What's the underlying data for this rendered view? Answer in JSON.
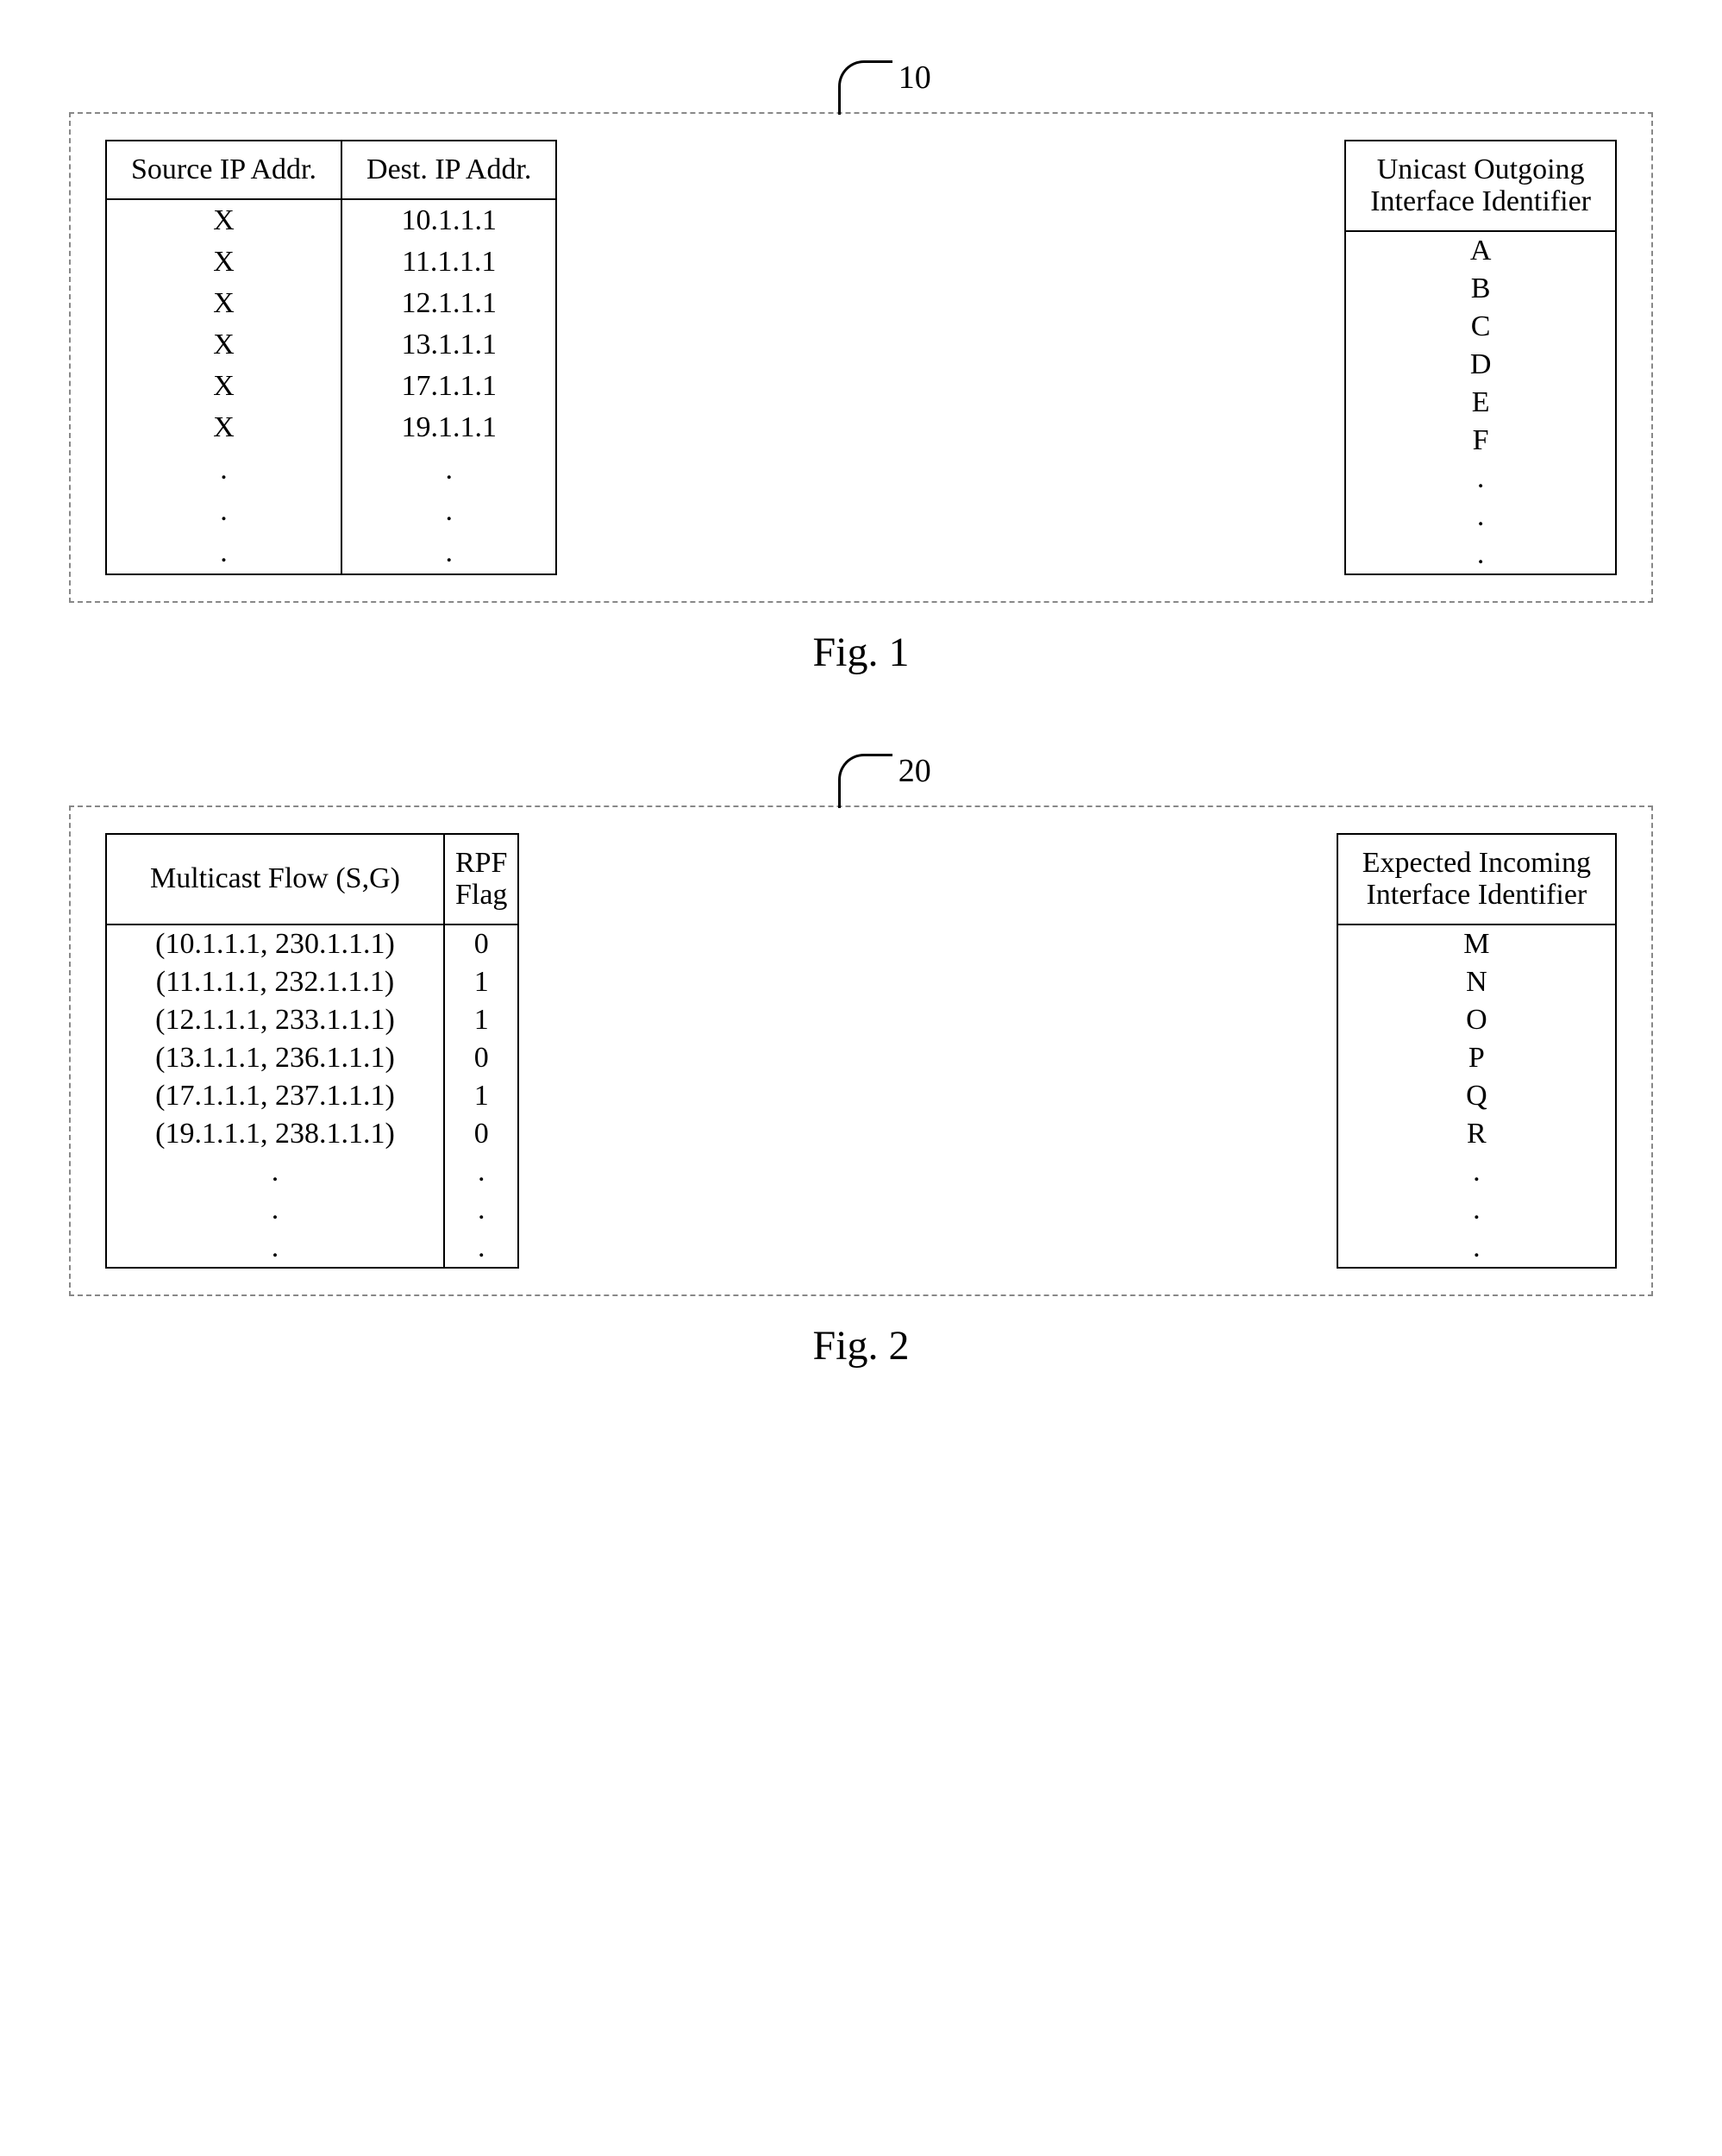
{
  "figure1": {
    "callout_label": "10",
    "caption": "Fig. 1",
    "left_table": {
      "headers": [
        "Source IP Addr.",
        "Dest. IP Addr."
      ],
      "rows": [
        [
          "X",
          "10.1.1.1"
        ],
        [
          "X",
          "11.1.1.1"
        ],
        [
          "X",
          "12.1.1.1"
        ],
        [
          "X",
          "13.1.1.1"
        ],
        [
          "X",
          "17.1.1.1"
        ],
        [
          "X",
          "19.1.1.1"
        ],
        [
          ".",
          "."
        ],
        [
          ".",
          "."
        ],
        [
          ".",
          "."
        ]
      ]
    },
    "right_table": {
      "header": "Unicast Outgoing\nInterface Identifier",
      "rows": [
        "A",
        "B",
        "C",
        "D",
        "E",
        "F",
        ".",
        ".",
        "."
      ]
    }
  },
  "figure2": {
    "callout_label": "20",
    "caption": "Fig. 2",
    "left_table": {
      "headers": [
        "Multicast Flow (S,G)",
        "RPF\nFlag"
      ],
      "rows": [
        [
          "(10.1.1.1, 230.1.1.1)",
          "0"
        ],
        [
          "(11.1.1.1, 232.1.1.1)",
          "1"
        ],
        [
          "(12.1.1.1, 233.1.1.1)",
          "1"
        ],
        [
          "(13.1.1.1, 236.1.1.1)",
          "0"
        ],
        [
          "(17.1.1.1, 237.1.1.1)",
          "1"
        ],
        [
          "(19.1.1.1, 238.1.1.1)",
          "0"
        ],
        [
          ".",
          "."
        ],
        [
          ".",
          "."
        ],
        [
          ".",
          "."
        ]
      ]
    },
    "right_table": {
      "header": "Expected Incoming\nInterface Identifier",
      "rows": [
        "M",
        "N",
        "O",
        "P",
        "Q",
        "R",
        ".",
        ".",
        "."
      ]
    }
  }
}
